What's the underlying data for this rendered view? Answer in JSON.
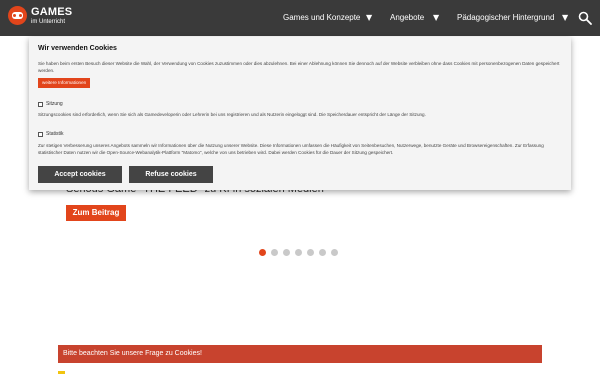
{
  "header": {
    "logo_title": "GAMES",
    "logo_subtitle": "im Unterricht",
    "nav": [
      {
        "label": "Games und Konzepte"
      },
      {
        "label": "Angebote"
      },
      {
        "label": "Pädagogischer Hintergrund"
      }
    ],
    "caret": "▼"
  },
  "hero": {
    "headline": "Serious Game \"THE FEED\" zu KI in sozialen Medien",
    "button_label": "Zum Beitrag",
    "slides_total": 7,
    "active_slide": 1
  },
  "cookie_dialog": {
    "title": "Wir verwenden Cookies",
    "intro": "Sie haben beim ersten Besuch dieser Website die Wahl, der Verwendung von Cookies zuzustimmen oder dies abzulehnen. Bei einer Ablehnung können Sie dennoch auf der Website verbleiben ohne dass Cookies mit personenbezogenen Daten gespeichert werden.",
    "more_info_label": "weitere Informationen",
    "options": [
      {
        "label": "Sitzung",
        "description": "Sitzungscookies sind erforderlich, wenn Sie sich als Gamedeveloperin oder Lehrerin bei uns registrieren und als Nutzerin eingeloggt sind. Die Speicherdauer entspricht der Länge der Sitzung."
      },
      {
        "label": "Statistik",
        "description": "Zur stetigen Verbesserung unseres Angebots sammeln wir Informationen über die Nutzung unserer Website. Diese Informationen umfassen die Häufigkeit von Seitenbesuchen, Nutzerwege, benutzte Geräte und Browsereigenschaften. Zur Erfassung statistischer Daten nutzen wir die Open-Source-Webanalytik-Plattform \"Matomo\", welche von uns betrieben wird. Dabei werden Cookies für die Dauer der Sitzung gespeichert."
      }
    ],
    "accept_label": "Accept cookies",
    "refuse_label": "Refuse cookies"
  },
  "notice": {
    "text": "Bitte beachten Sie unsere Frage zu Cookies!"
  },
  "colors": {
    "brand": "#e2451b",
    "header_bg": "#3a3a3a",
    "notice_bg": "#c8432e"
  }
}
